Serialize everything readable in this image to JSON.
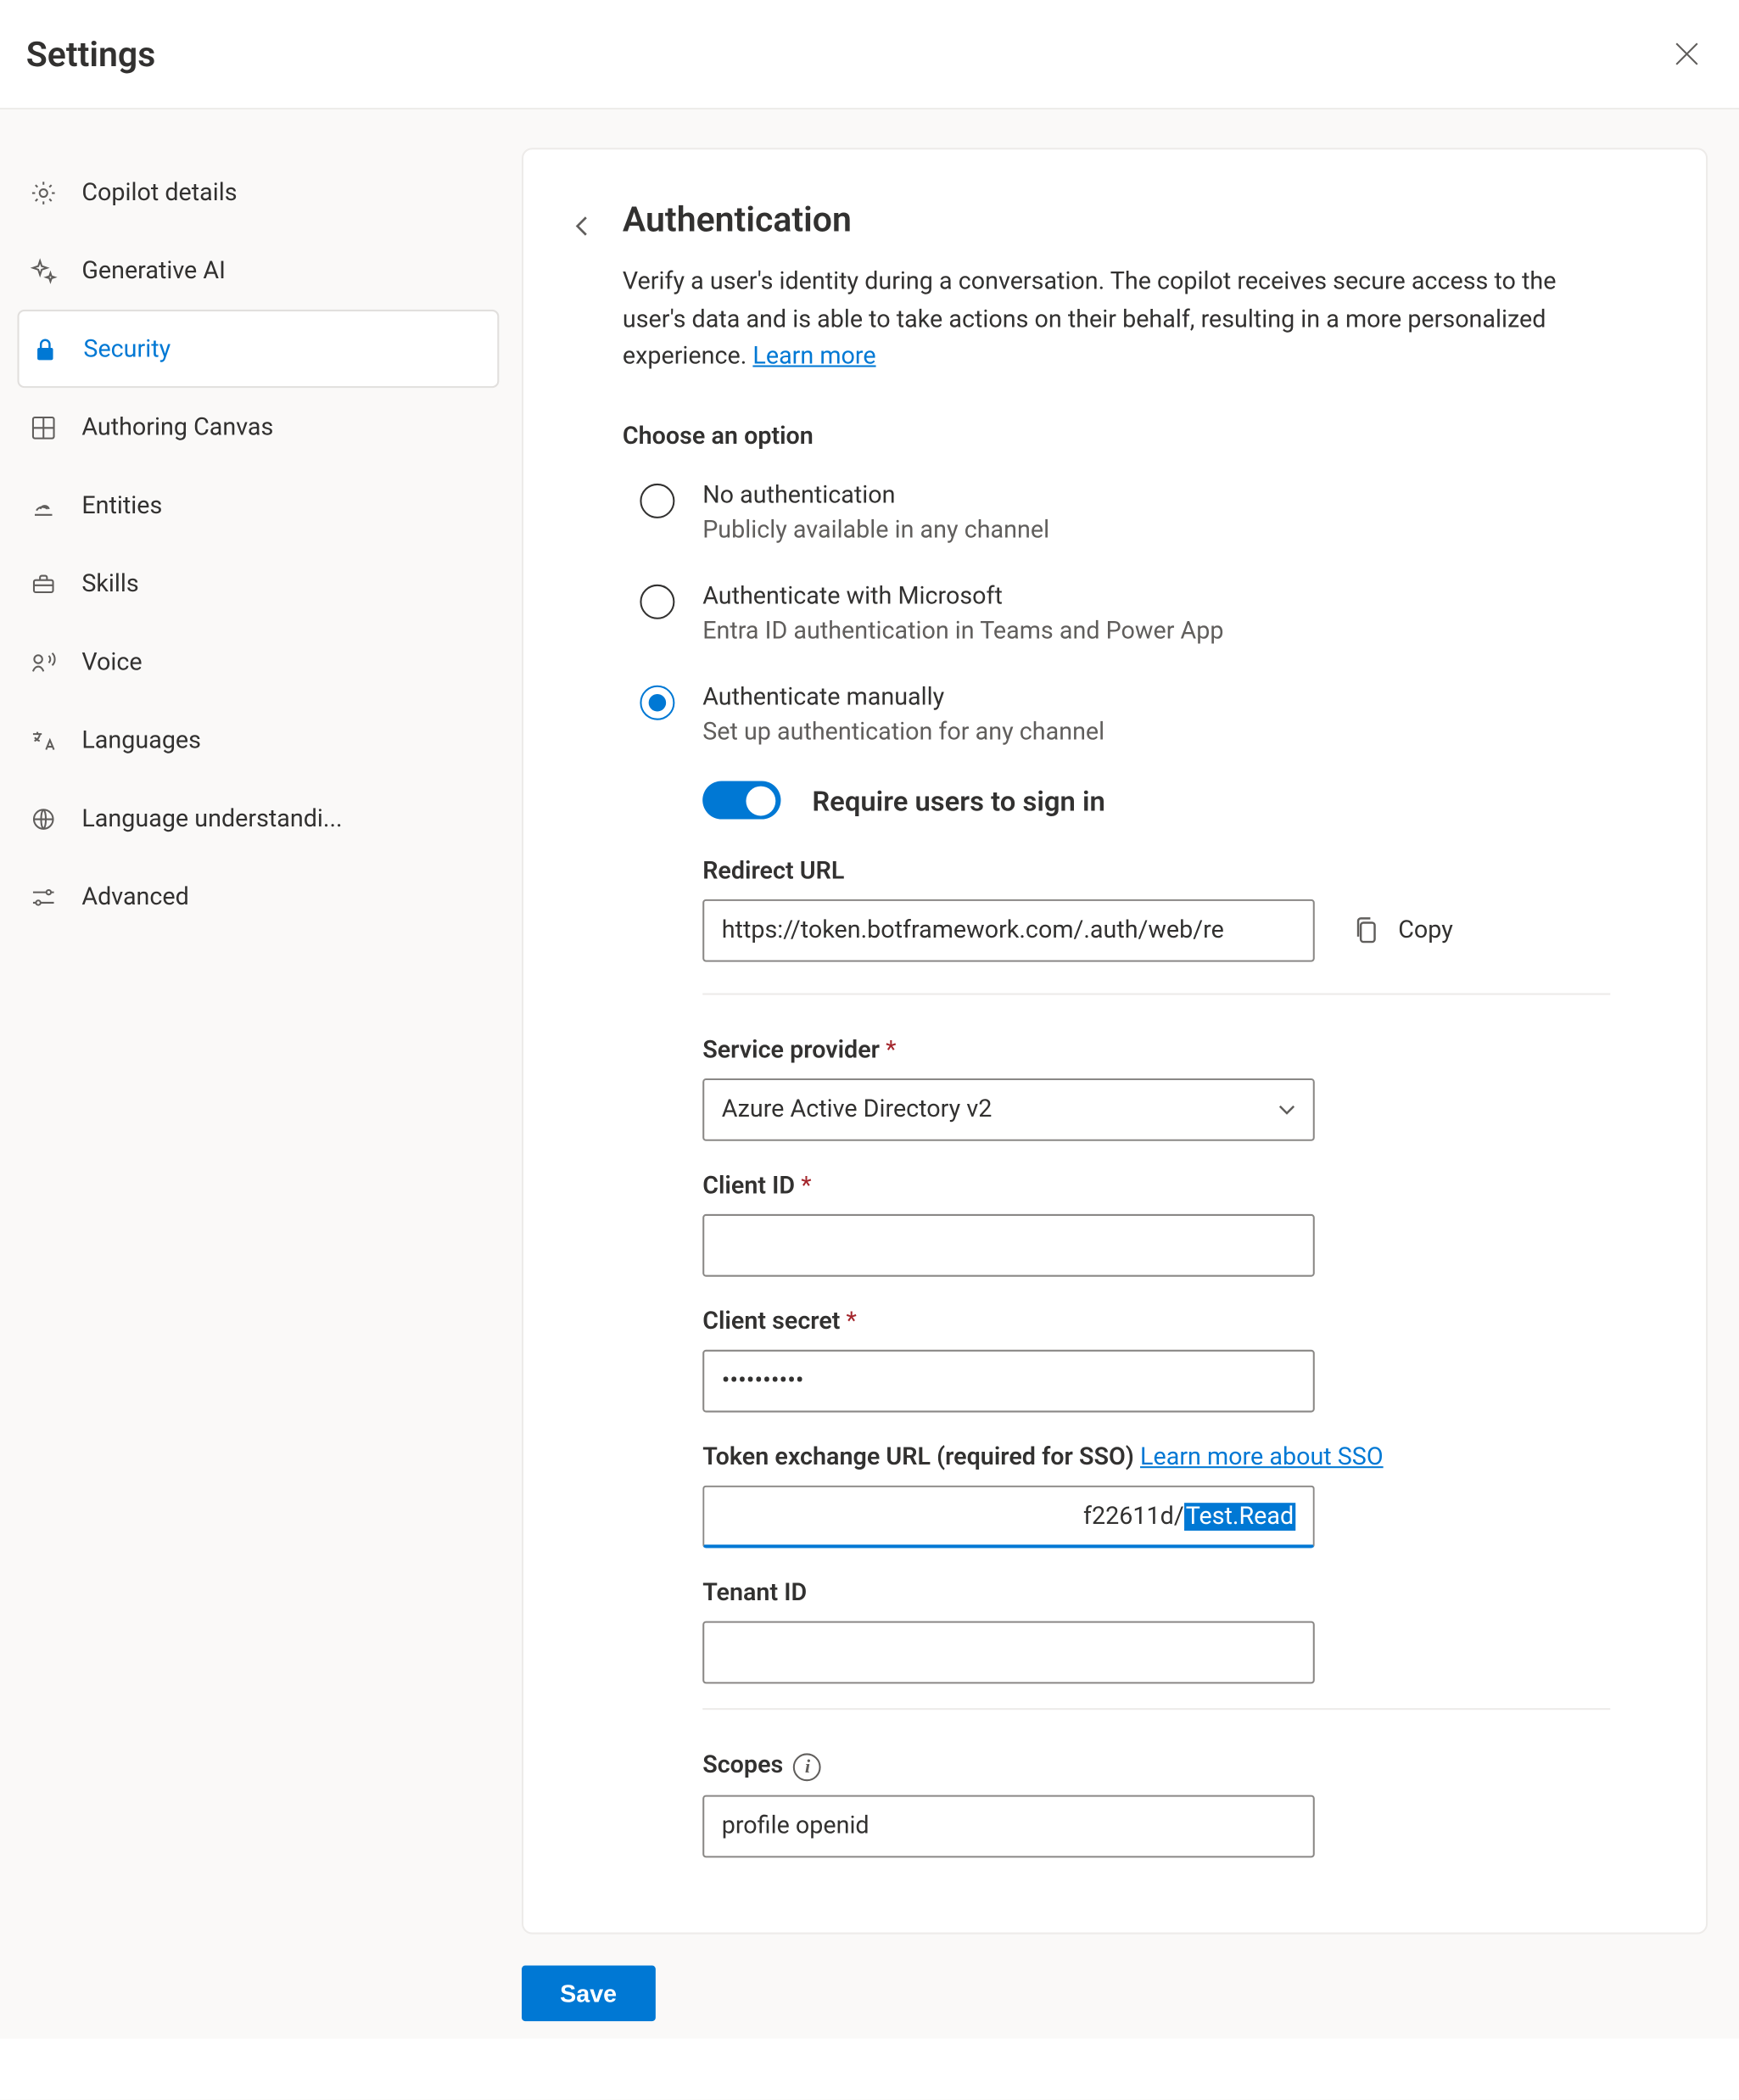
{
  "header": {
    "title": "Settings"
  },
  "sidebar": {
    "items": [
      {
        "label": "Copilot details"
      },
      {
        "label": "Generative AI"
      },
      {
        "label": "Security"
      },
      {
        "label": "Authoring Canvas"
      },
      {
        "label": "Entities"
      },
      {
        "label": "Skills"
      },
      {
        "label": "Voice"
      },
      {
        "label": "Languages"
      },
      {
        "label": "Language understandi..."
      },
      {
        "label": "Advanced"
      }
    ]
  },
  "auth": {
    "title": "Authentication",
    "description_pre": "Verify a user's identity during a conversation. The copilot receives secure access to the user's data and is able to take actions on their behalf, resulting in a more personalized experience. ",
    "learn_more": "Learn more",
    "choose_label": "Choose an option",
    "options": [
      {
        "title": "No authentication",
        "sub": "Publicly available in any channel"
      },
      {
        "title": "Authenticate with Microsoft",
        "sub": "Entra ID authentication in Teams and Power App"
      },
      {
        "title": "Authenticate manually",
        "sub": "Set up authentication for any channel"
      }
    ],
    "require_signin_label": "Require users to sign in",
    "redirect": {
      "label": "Redirect URL",
      "value": "https://token.botframework.com/.auth/web/re",
      "copy_label": "Copy"
    },
    "service_provider": {
      "label": "Service provider",
      "value": "Azure Active Directory v2"
    },
    "client_id": {
      "label": "Client ID",
      "value": ""
    },
    "client_secret": {
      "label": "Client secret",
      "value": "••••••••••"
    },
    "token_exchange": {
      "label_pre": "Token exchange URL (required for SSO) ",
      "learn_more": "Learn more about SSO",
      "value_plain": "f22611d/",
      "value_selected": "Test.Read"
    },
    "tenant_id": {
      "label": "Tenant ID",
      "value": ""
    },
    "scopes": {
      "label": "Scopes",
      "value": "profile openid"
    }
  },
  "footer": {
    "save_label": "Save"
  }
}
